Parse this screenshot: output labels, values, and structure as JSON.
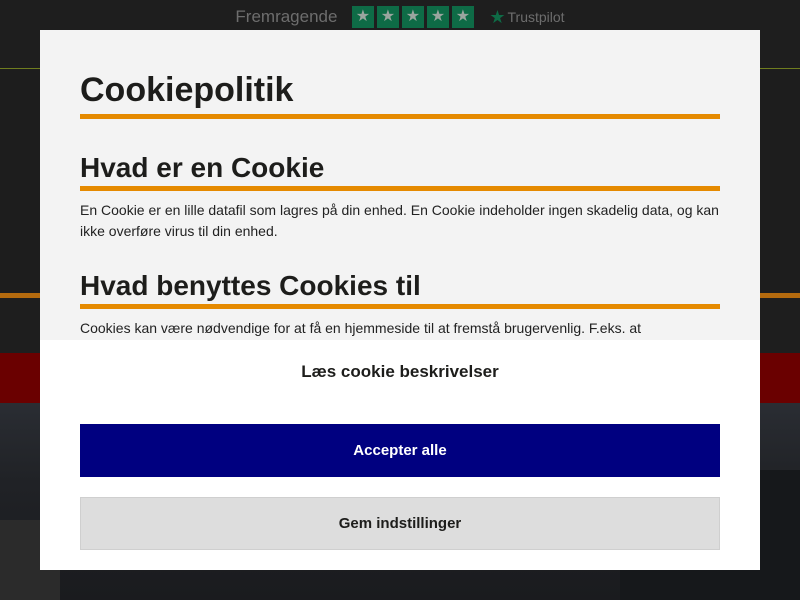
{
  "background": {
    "trustpilot_rating_text": "Fremragende",
    "trustpilot_logo_text": "Trustpilot",
    "star_count": 5,
    "colors": {
      "accent_orange": "#e58a00",
      "red_band": "#6a0000"
    }
  },
  "modal": {
    "title": "Cookiepolitik",
    "sections": [
      {
        "heading": "Hvad er en Cookie",
        "body": "En Cookie er en lille datafil som lagres på din enhed. En Cookie indeholder ingen skadelig data, og kan ikke overføre virus til din enhed."
      },
      {
        "heading": "Hvad benyttes Cookies til",
        "body": "Cookies kan være nødvendige for at få en hjemmeside til at fremstå brugervenlig. F.eks. at hjemmesiden husker din kurv, eller hvordan listen af produkter vises. Cookies bruges også til at indsamle information"
      }
    ],
    "read_descriptions_link": "Læs cookie beskrivelser",
    "accept_all_label": "Accepter alle",
    "save_settings_label": "Gem indstillinger",
    "colors": {
      "accept_button": "#000080",
      "save_button": "#dddddd"
    }
  }
}
